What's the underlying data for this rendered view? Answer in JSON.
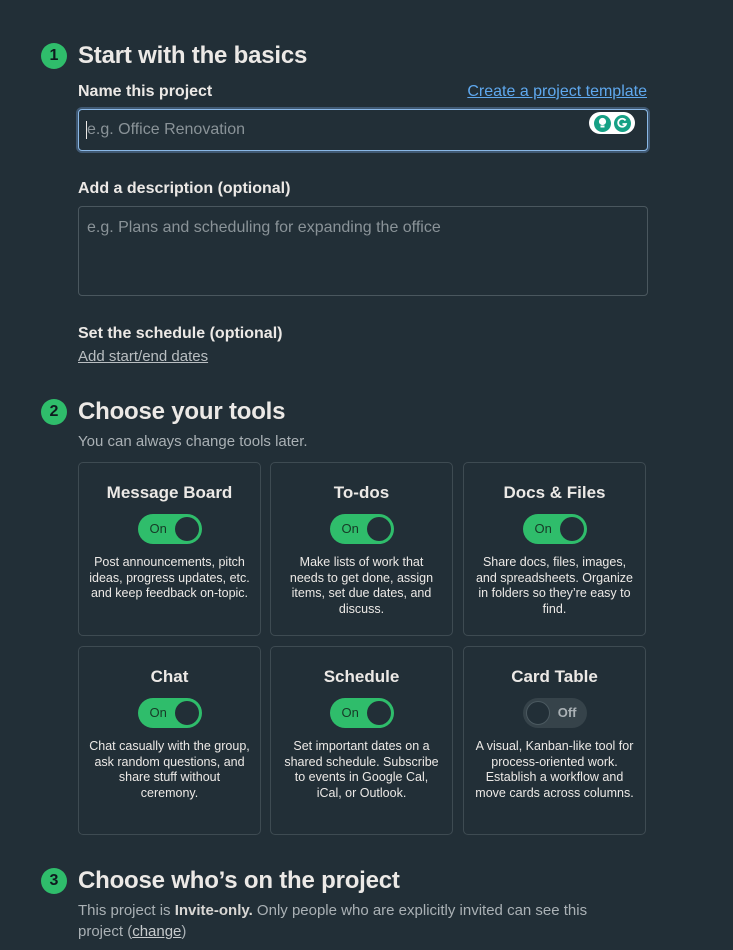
{
  "steps": [
    {
      "number": "1",
      "title": "Start with the basics"
    },
    {
      "number": "2",
      "title": "Choose your tools"
    },
    {
      "number": "3",
      "title": "Choose who’s on the project"
    }
  ],
  "basics": {
    "name_label": "Name this project",
    "template_link": "Create a project template",
    "name_value": "",
    "name_placeholder": "e.g. Office Renovation",
    "description_label": "Add a description (optional)",
    "description_value": "",
    "description_placeholder": "e.g. Plans and scheduling for expanding the office",
    "schedule_label": "Set the schedule (optional)",
    "schedule_link": "Add start/end dates",
    "extension_icons": [
      "lightbulb-icon",
      "grammarly-icon"
    ]
  },
  "tools": {
    "subtitle": "You can always change tools later.",
    "colors": {
      "on": "#2fbd6b",
      "off": "#36434a"
    },
    "items": [
      {
        "name": "Message Board",
        "state": "On",
        "enabled": true,
        "description": "Post announcements, pitch ideas, progress updates, etc. and keep feedback on-topic."
      },
      {
        "name": "To-dos",
        "state": "On",
        "enabled": true,
        "description": "Make lists of work that needs to get done, assign items, set due dates, and discuss."
      },
      {
        "name": "Docs & Files",
        "state": "On",
        "enabled": true,
        "description": "Share docs, files, images, and spreadsheets. Organize in folders so they’re easy to find."
      },
      {
        "name": "Chat",
        "state": "On",
        "enabled": true,
        "description": "Chat casually with the group, ask random questions, and share stuff without ceremony."
      },
      {
        "name": "Schedule",
        "state": "On",
        "enabled": true,
        "description": "Set important dates on a shared schedule. Subscribe to events in Google Cal, iCal, or Outlook."
      },
      {
        "name": "Card Table",
        "state": "Off",
        "enabled": false,
        "description": "A visual, Kanban-like tool for process-oriented work. Establish a workflow and move cards across columns."
      }
    ]
  },
  "people": {
    "text_before": "This project is ",
    "access_level": "Invite-only.",
    "text_after": " Only people who are explicitly invited can see this project (",
    "change_link": "change",
    "text_end": ")"
  }
}
